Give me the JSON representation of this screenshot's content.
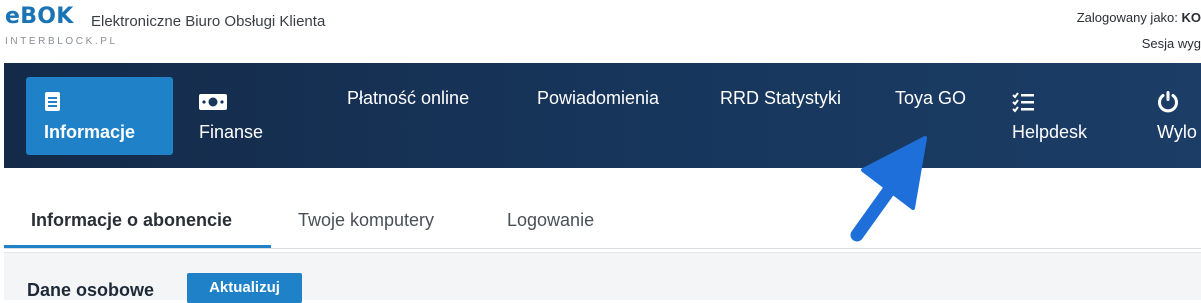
{
  "header": {
    "brand": "eBOK",
    "subtitle": "Elektroniczne Biuro Obsługi Klienta",
    "domain": "INTERBLOCK.PL",
    "logged_prefix": "Zalogowany jako: ",
    "logged_user": "KO",
    "session": "Sesja wyg"
  },
  "nav": [
    {
      "label": "Informacje",
      "icon": "document-icon",
      "active": true
    },
    {
      "label": "Finanse",
      "icon": "banknote-icon",
      "active": false
    },
    {
      "label": "Płatność online",
      "icon": "",
      "active": false
    },
    {
      "label": "Powiadomienia",
      "icon": "",
      "active": false
    },
    {
      "label": "RRD Statystyki",
      "icon": "",
      "active": false
    },
    {
      "label": "Toya GO",
      "icon": "",
      "active": false
    },
    {
      "label": "Helpdesk",
      "icon": "checklist-icon",
      "active": false
    },
    {
      "label": "Wylo",
      "icon": "power-icon",
      "active": false
    }
  ],
  "tabs": [
    {
      "label": "Informacje o abonencie",
      "active": true
    },
    {
      "label": "Twoje komputery",
      "active": false
    },
    {
      "label": "Logowanie",
      "active": false
    }
  ],
  "section": {
    "title": "Dane osobowe",
    "update_button": "Aktualizuj"
  },
  "colors": {
    "accent": "#1f82c8",
    "navbar": "#17365c",
    "arrow": "#1e6fd9"
  }
}
